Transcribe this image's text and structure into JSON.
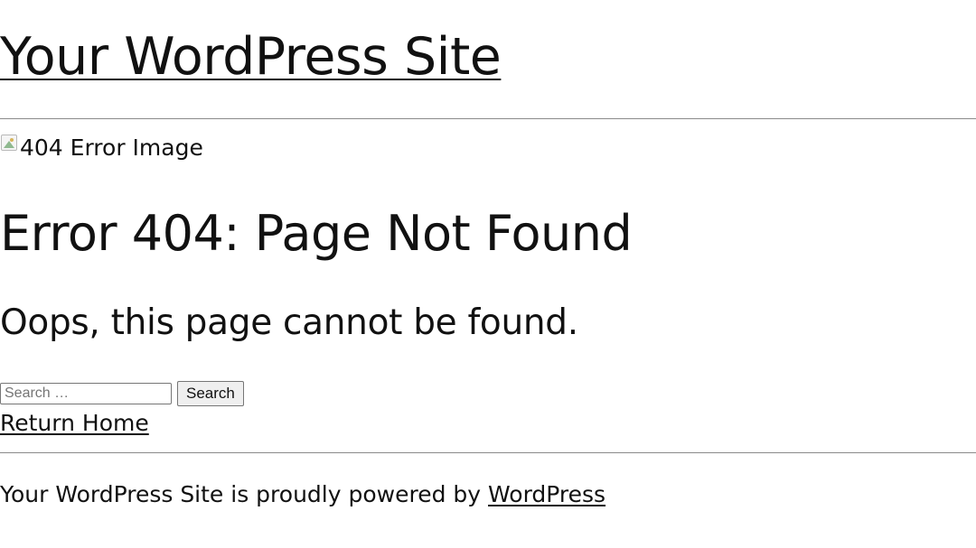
{
  "site": {
    "title": "Your WordPress Site"
  },
  "error_image": {
    "alt_text": "404 Error Image",
    "icon": "broken-image-icon"
  },
  "main": {
    "heading": "Error 404: Page Not Found",
    "message": "Oops, this page cannot be found."
  },
  "search": {
    "placeholder": "Search …",
    "value": "",
    "button_label": "Search"
  },
  "links": {
    "return_home": "Return Home"
  },
  "footer": {
    "text_prefix": "Your WordPress Site is proudly powered by ",
    "link_label": "WordPress"
  }
}
